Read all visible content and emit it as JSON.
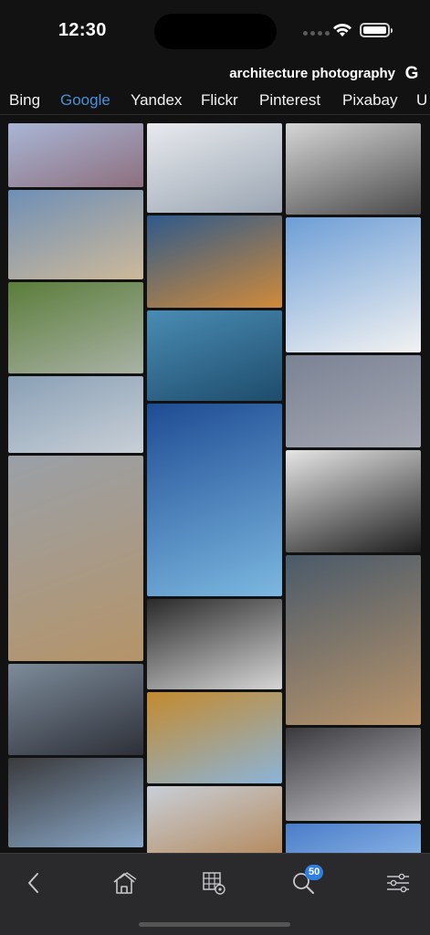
{
  "status_bar": {
    "time": "12:30"
  },
  "search": {
    "query": "architecture photography",
    "engine_icon": "G"
  },
  "tabs": [
    {
      "label": "Bing",
      "active": false
    },
    {
      "label": "Google",
      "active": true
    },
    {
      "label": "Yandex",
      "active": false
    },
    {
      "label": "Flickr",
      "active": false
    },
    {
      "label": "Pinterest",
      "active": false
    },
    {
      "label": "Pixabay",
      "active": false
    },
    {
      "label": "U",
      "active": false
    }
  ],
  "images": [
    {
      "subject": "dome-cathedral-skyline",
      "colors": [
        "#a9b6d6",
        "#8d6f7e"
      ]
    },
    {
      "subject": "classical-courtyard-building",
      "colors": [
        "#6f8fb6",
        "#cdb99a"
      ]
    },
    {
      "subject": "green-terraced-towers",
      "colors": [
        "#5b7d3a",
        "#a9b2a6"
      ]
    },
    {
      "subject": "modern-apartment-blocks",
      "colors": [
        "#8aa0b6",
        "#c8cfd6"
      ]
    },
    {
      "subject": "ornate-dome-church",
      "colors": [
        "#9aa0a8",
        "#b59468"
      ]
    },
    {
      "subject": "glass-skyscraper-night",
      "colors": [
        "#7d8b9a",
        "#2d3038"
      ]
    },
    {
      "subject": "curved-arch-structure",
      "colors": [
        "#3a3a3c",
        "#8aa8c8"
      ]
    },
    {
      "subject": "white-angular-building",
      "colors": [
        "#e8eaee",
        "#9aa5b2"
      ]
    },
    {
      "subject": "white-shell-pavilion-dusk",
      "colors": [
        "#2f5a8a",
        "#d08a3a"
      ]
    },
    {
      "subject": "blue-glass-waves",
      "colors": [
        "#4a8cb4",
        "#1e4c6c"
      ]
    },
    {
      "subject": "curved-blue-towers",
      "colors": [
        "#1e4c94",
        "#7cb8e0"
      ]
    },
    {
      "subject": "black-white-skyward-towers",
      "colors": [
        "#2a2a2a",
        "#d6d6d6"
      ]
    },
    {
      "subject": "golden-lattice-library",
      "colors": [
        "#c48a2e",
        "#8cb4d8"
      ]
    },
    {
      "subject": "indian-palace-domes",
      "colors": [
        "#c8cfd8",
        "#b4885a"
      ]
    },
    {
      "subject": "spiral-glass-dome",
      "colors": [
        "#d6d6d6",
        "#4a4a4a"
      ]
    },
    {
      "subject": "white-curved-balcony",
      "colors": [
        "#6d9ed6",
        "#f2f2f2"
      ]
    },
    {
      "subject": "green-dome-birds",
      "colors": [
        "#7a8294",
        "#a6a8b2"
      ]
    },
    {
      "subject": "vessel-staircase",
      "colors": [
        "#e6e6e6",
        "#1e1e1e"
      ]
    },
    {
      "subject": "cathedral-reflection",
      "colors": [
        "#4a5a6a",
        "#b8946a"
      ]
    },
    {
      "subject": "perforated-facade",
      "colors": [
        "#3a3a3e",
        "#c8c8cc"
      ]
    },
    {
      "subject": "blue-sky-facade",
      "colors": [
        "#4a7cc8",
        "#8ab4e6"
      ]
    }
  ],
  "toolbar": {
    "badge_count": "50"
  }
}
